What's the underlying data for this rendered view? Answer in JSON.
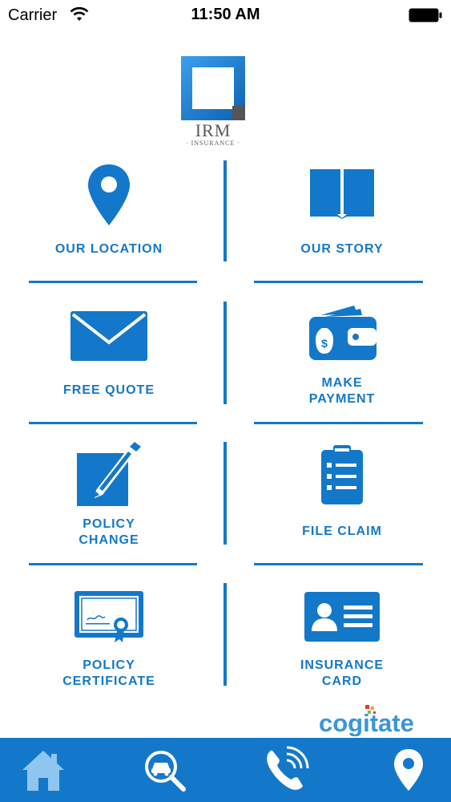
{
  "status_bar": {
    "carrier": "Carrier",
    "time": "11:50 AM"
  },
  "logo": {
    "name": "IRM",
    "subtitle": "· INSURANCE ·"
  },
  "tiles": [
    {
      "label": "OUR LOCATION",
      "icon": "location-pin-icon"
    },
    {
      "label": "OUR STORY",
      "icon": "book-icon"
    },
    {
      "label": "FREE QUOTE",
      "icon": "envelope-icon"
    },
    {
      "label": "MAKE\nPAYMENT",
      "icon": "wallet-icon"
    },
    {
      "label": "POLICY\nCHANGE",
      "icon": "edit-pencil-icon"
    },
    {
      "label": "FILE CLAIM",
      "icon": "clipboard-icon"
    },
    {
      "label": "POLICY\nCERTIFICATE",
      "icon": "certificate-icon"
    },
    {
      "label": "INSURANCE\nCARD",
      "icon": "id-card-icon"
    }
  ],
  "brand": {
    "name": "cogitate"
  },
  "tabbar": {
    "items": [
      "home-icon",
      "car-search-icon",
      "phone-icon",
      "location-icon"
    ]
  },
  "colors": {
    "accent": "#1378c9",
    "tabbar": "#1378c9",
    "text_status": "#000000"
  }
}
